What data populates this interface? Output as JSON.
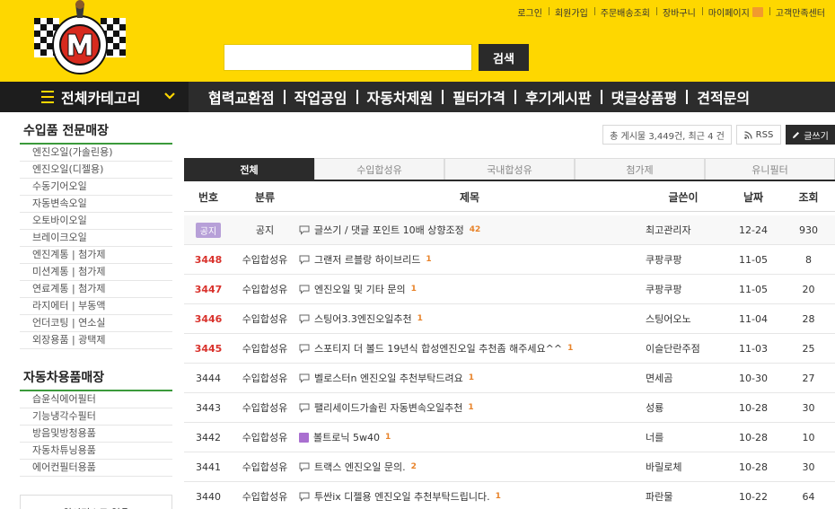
{
  "header": {
    "top_links": [
      "로그인",
      "회원가입",
      "주문배송조회",
      "장바구니",
      "마이페이지",
      "고객만족센터"
    ],
    "search": {
      "value": "",
      "button_label": "검색"
    }
  },
  "nav": {
    "all_categories": "전체카테고리",
    "items": [
      "협력교환점",
      "작업공임",
      "자동차제원",
      "필터가격",
      "후기게시판",
      "댓글상품평",
      "견적문의"
    ]
  },
  "sidebar": {
    "section1_title": "수입품 전문매장",
    "section1_items": [
      "엔진오일(가솔린용)",
      "엔진오일(디젤용)",
      "수동기어오일",
      "자동변속오일",
      "오토바이오일",
      "브레이크오일",
      "엔진계통 | 첨가제",
      "미션계통 | 첨가제",
      "연료계통 | 첨가제",
      "라지에터 | 부동액",
      "언더코팅 | 연소실",
      "외장용품 | 광택제"
    ],
    "section2_title": "자동차용품매장",
    "section2_items": [
      "습윤식에어필터",
      "기능냉각수필터",
      "방음및방청용품",
      "자동차튜닝용품",
      "에어컨필터용품"
    ],
    "wishlist": "위시리스트 없음"
  },
  "board": {
    "count_text": "총 게시물 3,449건, 최근 4 건",
    "rss_label": "RSS",
    "write_label": "글쓰기",
    "tabs": [
      "전체",
      "수입합성유",
      "국내합성유",
      "첨가제",
      "유니필터"
    ],
    "active_tab": 0,
    "columns": {
      "no": "번호",
      "category": "분류",
      "title": "제목",
      "author": "글쓴이",
      "date": "날짜",
      "views": "조회"
    },
    "rows": [
      {
        "no": "공지",
        "category": "공지",
        "title": "글쓰기 / 댓글 포인트 10배 상향조정",
        "comments": "42",
        "author": "최고관리자",
        "date": "12-24",
        "views": "930"
      },
      {
        "no": "3448",
        "category": "수입합성유",
        "title": "그랜저 르블랑 하이브리드",
        "comments": "1",
        "author": "쿠팡쿠팡",
        "date": "11-05",
        "views": "8"
      },
      {
        "no": "3447",
        "category": "수입합성유",
        "title": "엔진오일 및 기타 문의",
        "comments": "1",
        "author": "쿠팡쿠팡",
        "date": "11-05",
        "views": "20"
      },
      {
        "no": "3446",
        "category": "수입합성유",
        "title": "스팅어3.3엔진오일추천",
        "comments": "1",
        "author": "스팅어오노",
        "date": "11-04",
        "views": "28"
      },
      {
        "no": "3445",
        "category": "수입합성유",
        "title": "스포티지 더 볼드 19년식 합성엔진오일 추천좀 해주세요^^",
        "comments": "1",
        "author": "이슬단란주점",
        "date": "11-03",
        "views": "25"
      },
      {
        "no": "3444",
        "category": "수입합성유",
        "title": "벨로스터n 엔진오일 추천부탁드려요",
        "comments": "1",
        "author": "면세곰",
        "date": "10-30",
        "views": "27"
      },
      {
        "no": "3443",
        "category": "수입합성유",
        "title": "팰리세이드가솔린 자동변속오일추천",
        "comments": "1",
        "author": "성룡",
        "date": "10-28",
        "views": "30"
      },
      {
        "no": "3442",
        "category": "수입합성유",
        "title": "볼트로닉 5w40",
        "comments": "1",
        "author": "너를",
        "date": "10-28",
        "views": "10"
      },
      {
        "no": "3441",
        "category": "수입합성유",
        "title": "트랙스 엔진오일 문의.",
        "comments": "2",
        "author": "바릴로체",
        "date": "10-28",
        "views": "30"
      },
      {
        "no": "3440",
        "category": "수입합성유",
        "title": "투싼ix 디젤용 엔진오일 추천부탁드립니다.",
        "comments": "1",
        "author": "파란물",
        "date": "10-22",
        "views": "64"
      }
    ]
  },
  "colors": {
    "brand_yellow": "#fed700",
    "nav_dark": "#2c2c2c",
    "accent_green": "#3b9a3b",
    "number_red": "#d9322c"
  }
}
